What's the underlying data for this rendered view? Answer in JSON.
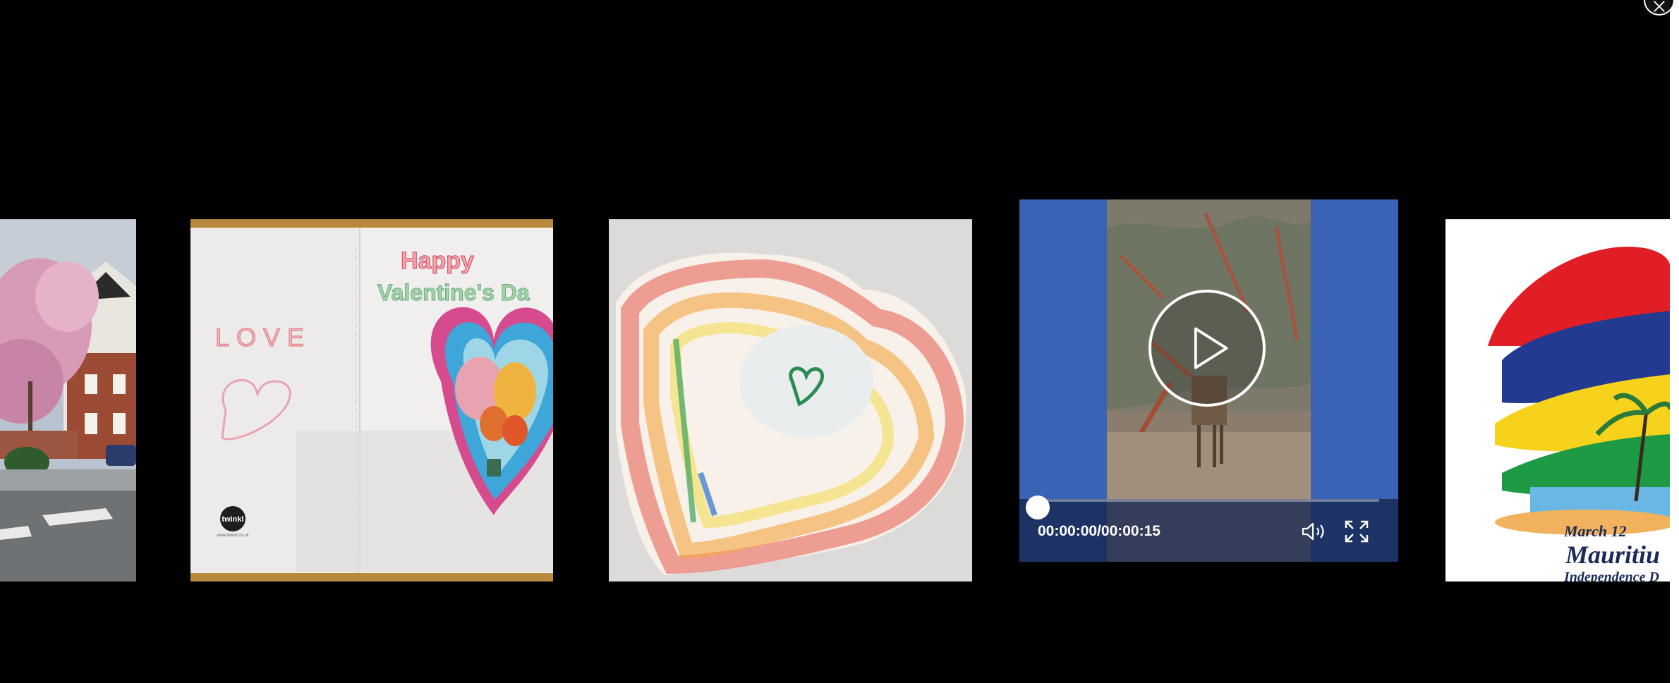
{
  "gallery": {
    "items": [
      {
        "kind": "photo",
        "subject": "magnolia-tree-street"
      },
      {
        "kind": "photo",
        "subject": "valentines-card",
        "card_title_line1": "Happy",
        "card_title_line2": "Valentine's Da",
        "card_word": "LOVE",
        "brand": "twinkl",
        "url_small": "www.twinkl.co.uk"
      },
      {
        "kind": "photo",
        "subject": "crayon-heart-drawing"
      },
      {
        "kind": "video",
        "subject": "giraffe-in-trees"
      },
      {
        "kind": "photo",
        "subject": "mauritius-flag-poster",
        "line1": "March 12",
        "line2": "Mauritiu",
        "line3": "Independence D"
      }
    ]
  },
  "player": {
    "time_display": "00:00:00/00:00:15",
    "progress": 0.0,
    "colors": {
      "pillarbox": "#3a62b5",
      "controls_bg": "#162650"
    }
  },
  "icons": {
    "play": "play-icon",
    "volume": "volume-icon",
    "fullscreen": "fullscreen-icon",
    "close": "close-icon"
  }
}
